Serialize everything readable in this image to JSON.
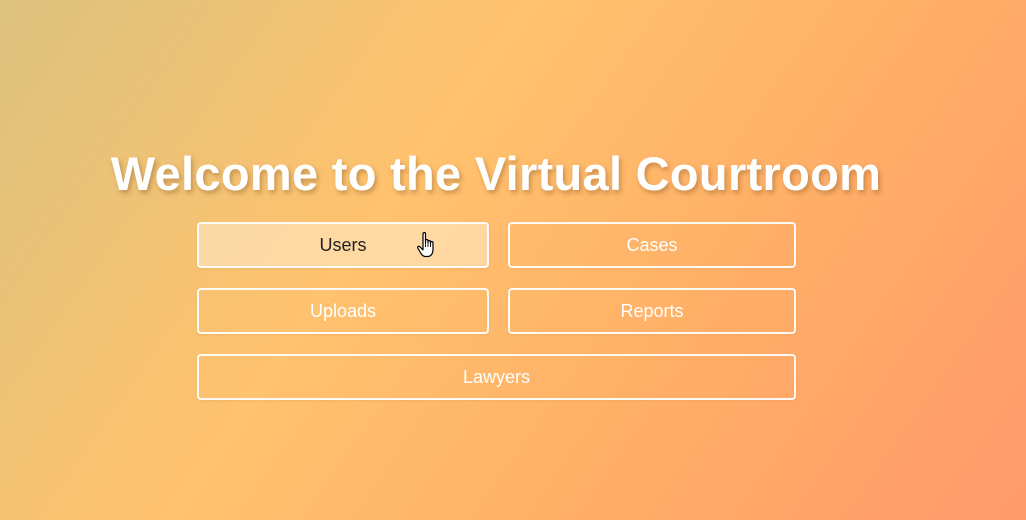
{
  "page": {
    "title": "Welcome to the Virtual Courtroom"
  },
  "menu": {
    "users_label": "Users",
    "cases_label": "Cases",
    "uploads_label": "Uploads",
    "reports_label": "Reports",
    "lawyers_label": "Lawyers"
  },
  "state": {
    "hovered_button": "Users",
    "cursor": "hand-pointer-icon"
  },
  "colors": {
    "gradient_start": "#dcc27d",
    "gradient_mid": "#ffc26e",
    "gradient_end": "#ff9a6a",
    "button_border": "#ffffff",
    "button_text": "#ffffff",
    "hover_text": "#222222"
  }
}
